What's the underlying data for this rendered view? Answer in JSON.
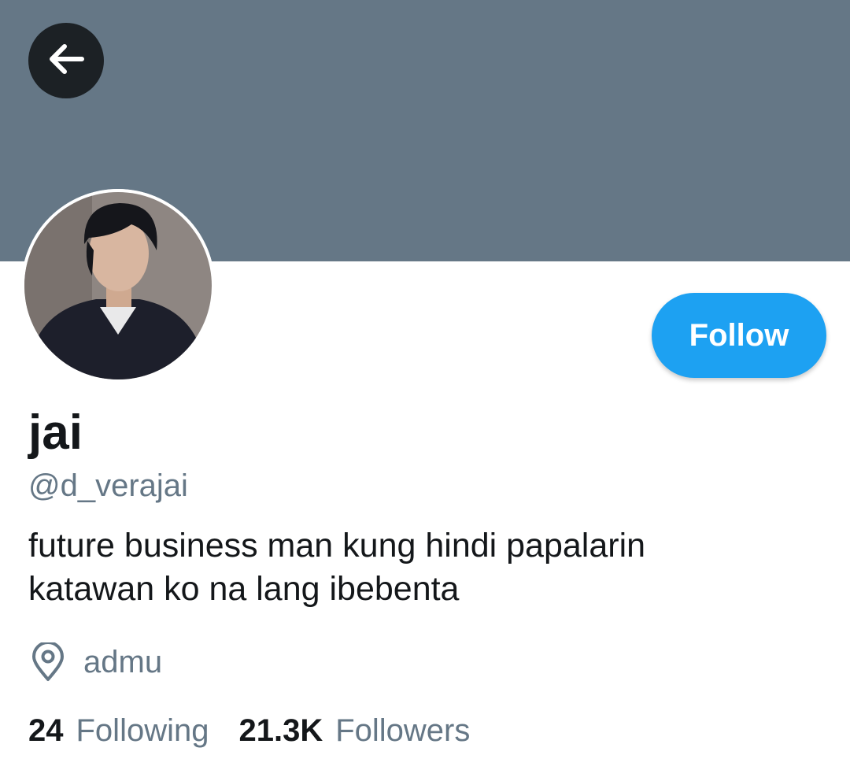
{
  "colors": {
    "banner": "#657786",
    "accent": "#1da1f2",
    "text_primary": "#14171a",
    "text_secondary": "#657786",
    "back_button_bg": "#1c2125"
  },
  "header": {
    "back_icon": "arrow-left-icon"
  },
  "profile": {
    "display_name": "jai",
    "handle": "@d_verajai",
    "bio_lines": [
      "future business man kung hindi papalarin",
      "katawan ko na lang ibebenta"
    ],
    "location_icon": "location-pin-icon",
    "location": "admu"
  },
  "actions": {
    "follow_label": "Follow"
  },
  "stats": {
    "following_count": "24",
    "following_label": "Following",
    "followers_count": "21.3K",
    "followers_label": "Followers"
  }
}
